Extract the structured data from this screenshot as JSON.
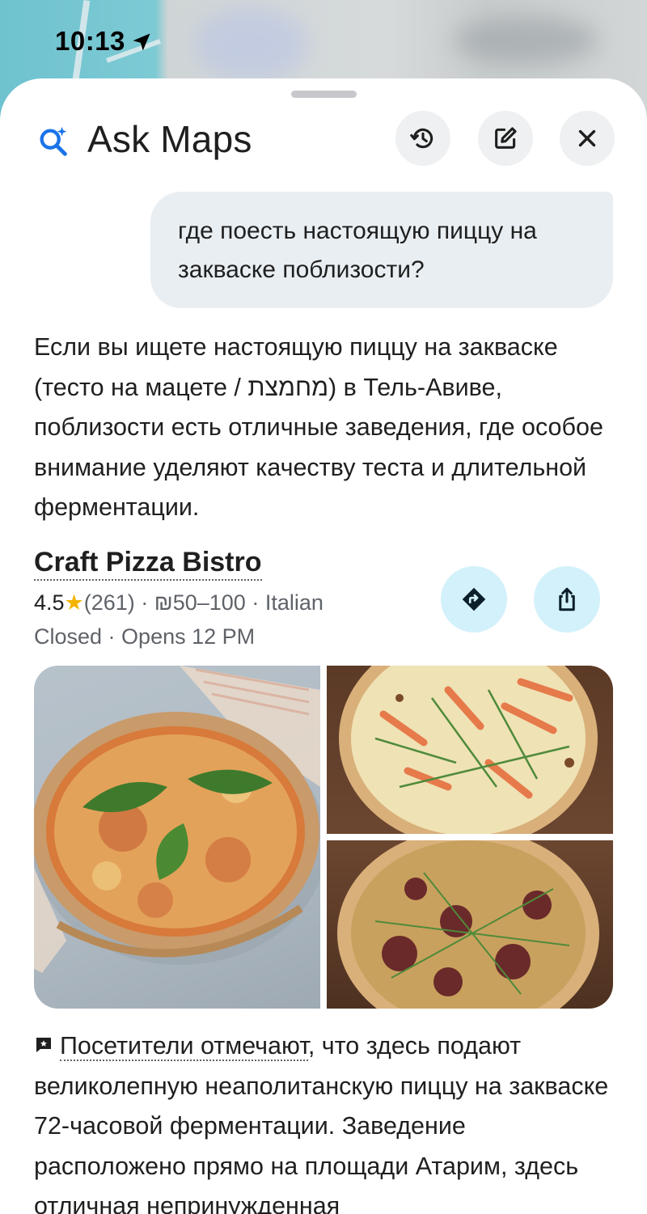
{
  "status_bar": {
    "time": "10:13"
  },
  "header": {
    "title": "Ask Maps",
    "buttons": [
      "history-icon",
      "edit-icon",
      "close-icon"
    ]
  },
  "conversation": {
    "user_query": "где поесть настоящую пиццу на закваске поблизости?",
    "answer_intro": "Если вы ищете настоящую пиццу на закваске (тесто на мацете / מחמצת) в Тель-Авиве, поблизости есть отличные заведения, где особое внимание уделяют качеству теста и длительной ферментации."
  },
  "place": {
    "name": "Craft Pizza Bistro",
    "rating": "4.5",
    "reviews": "(261)",
    "price": "₪50–100",
    "category": "Italian",
    "status": "Closed",
    "hours": "Opens 12 PM",
    "sep": " · ",
    "review_lead": "Посетители отмечают",
    "review_text": ", что здесь подают великолепную неаполитанскую пиццу на закваске 72-часовой ферментации. Заведение расположено прямо на площади Атарим, здесь отличная непринужденная"
  },
  "colors": {
    "accent_blue": "#1a73e8",
    "action_bg": "#d3f1fb",
    "star": "#f4b400"
  }
}
